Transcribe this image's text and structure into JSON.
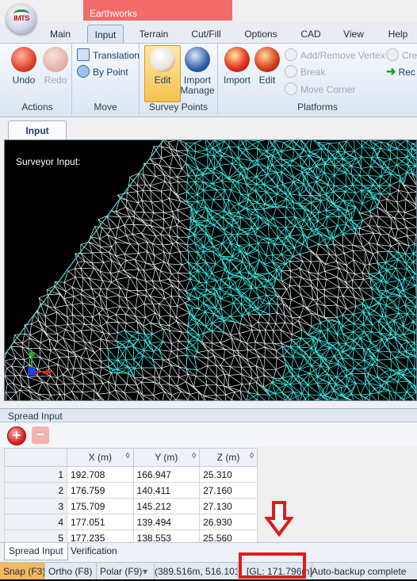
{
  "app": {
    "title": "Earthworks"
  },
  "ribbon_tabs": [
    "Main",
    "Input",
    "Terrain",
    "Cut/Fill",
    "Options",
    "CAD",
    "View",
    "Help"
  ],
  "active_ribbon_tab": "Input",
  "ribbon": {
    "actions": {
      "label": "Actions",
      "undo": "Undo",
      "redo": "Redo"
    },
    "move": {
      "label": "Move",
      "translation": "Translation",
      "by_point": "By Point"
    },
    "survey_points": {
      "label": "Survey Points",
      "edit": "Edit",
      "import_manage": "Import\nManage"
    },
    "platforms": {
      "label": "Platforms",
      "import": "Import",
      "edit": "Edit",
      "add_remove_vertex": "Add/Remove Vertex",
      "break": "Break",
      "move_corner": "Move Corner",
      "cre_truncated": "Cre",
      "rec_truncated": "Rec"
    }
  },
  "document_tab": "Input",
  "viewport": {
    "label": "Surveyor Input:"
  },
  "spread_input": {
    "title": "Spread Input",
    "columns": [
      "X (m)",
      "Y (m)",
      "Z (m)"
    ],
    "rows": [
      {
        "n": "1",
        "x": "192.708",
        "y": "166.947",
        "z": "25.310"
      },
      {
        "n": "2",
        "x": "176.759",
        "y": "140.411",
        "z": "27.160"
      },
      {
        "n": "3",
        "x": "175.709",
        "y": "145.212",
        "z": "27.130"
      },
      {
        "n": "4",
        "x": "177.051",
        "y": "139.494",
        "z": "26.930"
      },
      {
        "n": "5",
        "x": "177.235",
        "y": "138.553",
        "z": "25.560"
      }
    ]
  },
  "bottom_tabs": [
    "Spread Input",
    "Verification"
  ],
  "status": {
    "snap": "Snap (F3)",
    "ortho": "Ortho (F8)",
    "polar": "Polar (F9)",
    "coords": "(389.516m, 516.101m",
    "gl": "[GL: 171.796m]",
    "message": "Auto-backup complete"
  },
  "colors": {
    "mesh": "#3ee6e0",
    "background": "#000000",
    "snap_on": "#f4b860",
    "annotation": "#e01b1b"
  },
  "icons": {
    "add_row": "plus-circle-icon",
    "delete_row": "minus-icon",
    "annotation": "down-arrow-icon"
  }
}
